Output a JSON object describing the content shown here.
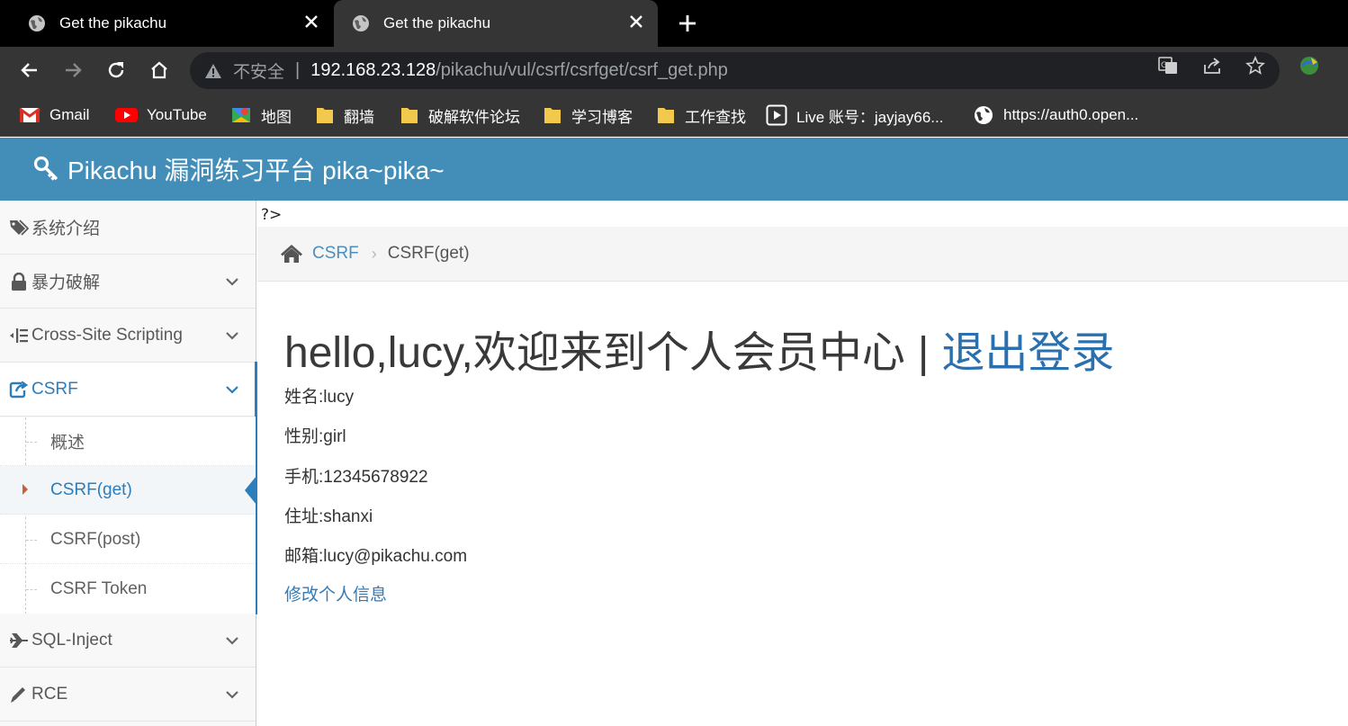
{
  "browser": {
    "tabs": [
      {
        "title": "Get the pikachu"
      },
      {
        "title": "Get the pikachu"
      }
    ],
    "address": {
      "security_label": "不安全",
      "host": "192.168.23.128",
      "path": "/pikachu/vul/csrf/csrfget/csrf_get.php"
    },
    "bookmarks": [
      {
        "label": "Gmail",
        "icon": "gmail-icon"
      },
      {
        "label": "YouTube",
        "icon": "youtube-icon"
      },
      {
        "label": "地图",
        "icon": "maps-icon"
      },
      {
        "label": "翻墙",
        "icon": "folder-icon"
      },
      {
        "label": "破解软件论坛",
        "icon": "folder-icon"
      },
      {
        "label": "学习博客",
        "icon": "folder-icon"
      },
      {
        "label": "工作查找",
        "icon": "folder-icon"
      },
      {
        "label": "Live  账号：jayjay66...",
        "icon": "play-icon"
      },
      {
        "label": "https://auth0.open...",
        "icon": "globe-icon"
      }
    ]
  },
  "header": {
    "brand": "Pikachu 漏洞练习平台 pika~pika~"
  },
  "sidebar": {
    "items": [
      {
        "label": "系统介绍",
        "icon": "tags-icon"
      },
      {
        "label": "暴力破解",
        "icon": "lock-icon"
      },
      {
        "label": "Cross-Site Scripting",
        "icon": "indent-icon"
      },
      {
        "label": "CSRF",
        "icon": "share-square-icon",
        "active": true
      },
      {
        "label": "SQL-Inject",
        "icon": "plane-icon"
      },
      {
        "label": "RCE",
        "icon": "pencil-icon"
      }
    ],
    "csrf_sub": [
      {
        "label": "概述"
      },
      {
        "label": "CSRF(get)",
        "active": true
      },
      {
        "label": "CSRF(post)"
      },
      {
        "label": "CSRF Token"
      }
    ]
  },
  "main": {
    "php_residue": "?>",
    "breadcrumb": {
      "parent": "CSRF",
      "current": "CSRF(get)"
    },
    "welcome_text": "hello,lucy,欢迎来到个人会员中心",
    "separator": "|",
    "logout_label": "退出登录",
    "info": [
      "姓名:lucy",
      "性别:girl",
      "手机:12345678922",
      "住址:shanxi",
      "邮箱:lucy@pikachu.com"
    ],
    "edit_link": "修改个人信息"
  },
  "colors": {
    "navbar": "#438eb9",
    "accent": "#2b7dbc",
    "chrome_dark": "#353535"
  }
}
